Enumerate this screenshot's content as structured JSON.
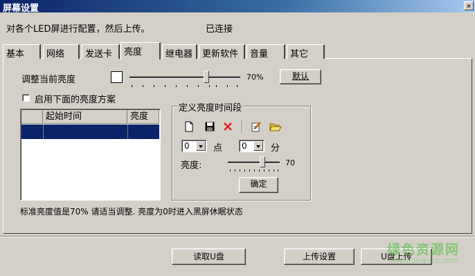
{
  "window": {
    "title": "屏幕设置",
    "close_label": "×"
  },
  "header": {
    "instruction": "对各个LED屏进行配置，然后上传。",
    "status": "已连接"
  },
  "tabs": [
    {
      "label": "基本"
    },
    {
      "label": "网络"
    },
    {
      "label": "发送卡"
    },
    {
      "label": "亮度",
      "active": true
    },
    {
      "label": "继电器"
    },
    {
      "label": "更新软件"
    },
    {
      "label": "音量"
    },
    {
      "label": "其它"
    }
  ],
  "brightness": {
    "label": "调整当前亮度",
    "value_text": "70%",
    "value": 70,
    "default_button": "默认",
    "enable_schedule_label": "启用下面的亮度方案",
    "enable_schedule_checked": false
  },
  "schedule_table": {
    "columns": [
      "起始时间",
      "亮度"
    ],
    "rows": []
  },
  "time_group": {
    "legend": "定义亮度时间段",
    "toolbar_icons": [
      "new-file-icon",
      "save-icon",
      "delete-icon",
      "edit-icon",
      "open-folder-icon"
    ],
    "hour_value": "0",
    "hour_unit": "点",
    "minute_value": "0",
    "minute_unit": "分",
    "brightness_label": "亮度:",
    "brightness_value": "70",
    "confirm_button": "确定"
  },
  "note": "标准亮度值是70% 请适当调整. 亮度为0时进入黑屏休眠状态",
  "footer": {
    "read_usb_button": "读取U盘",
    "upload_settings_button": "上传设置",
    "usb_upload_button": "U盘上传"
  },
  "watermark": {
    "text": "绿色资源网",
    "url": "www.downcc.com"
  },
  "colors": {
    "titlebar": "#0a246a",
    "selection": "#0a246a",
    "face": "#d4d0c8",
    "watermark": "#5cc04a"
  }
}
